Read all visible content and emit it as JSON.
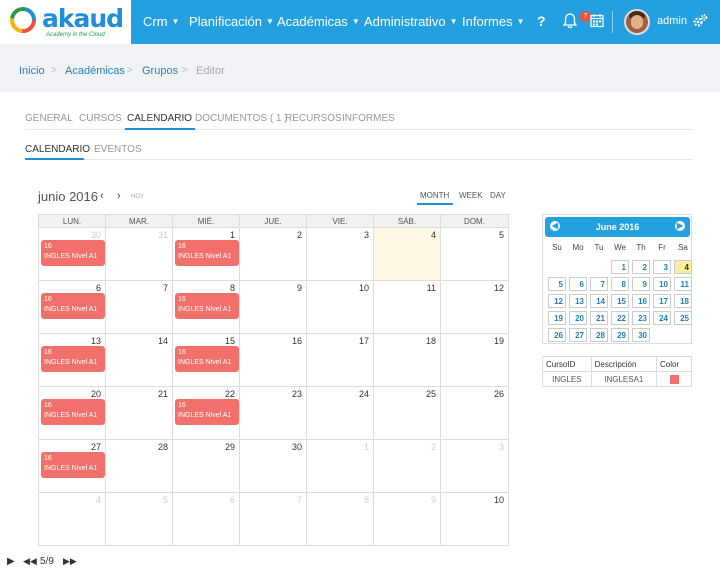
{
  "app": {
    "logo_text": "akaud",
    "logo_sub": "Academy in the Cloud"
  },
  "topnav": {
    "items": [
      "Crm",
      "Planificación",
      "Académicas",
      "Administrativo",
      "Informes"
    ],
    "help": "?",
    "notif_count": "7",
    "user": "admin"
  },
  "breadcrumb": {
    "items": [
      "Inicio",
      "Académicas",
      "Grupos"
    ],
    "current": "Editor"
  },
  "tabs": [
    "GENERAL",
    "CURSOS",
    "CALENDARIO",
    "DOCUMENTOS ( 1 )",
    "RECURSOS",
    "INFORMES"
  ],
  "active_tab": "CALENDARIO",
  "subtabs": [
    "CALENDARIO",
    "EVENTOS"
  ],
  "calendar": {
    "title": "junio 2016",
    "prev": "‹",
    "next": "›",
    "today_label": "HOY",
    "views": [
      "MONTH",
      "WEEK",
      "DAY"
    ],
    "active_view": "MONTH",
    "dow": [
      "LUN.",
      "MAR.",
      "MIÉ.",
      "JUE.",
      "VIE.",
      "SÁB.",
      "DOM."
    ],
    "weeks": [
      [
        "30",
        "31",
        "1",
        "2",
        "3",
        "4",
        "5"
      ],
      [
        "6",
        "7",
        "8",
        "9",
        "10",
        "11",
        "12"
      ],
      [
        "13",
        "14",
        "15",
        "16",
        "17",
        "18",
        "19"
      ],
      [
        "20",
        "21",
        "22",
        "23",
        "24",
        "25",
        "26"
      ],
      [
        "27",
        "28",
        "29",
        "30",
        "1",
        "2",
        "3"
      ],
      [
        "4",
        "5",
        "6",
        "7",
        "8",
        "9",
        "10"
      ]
    ],
    "event_line1": "16",
    "event_line2": "INGLES Nivel A1"
  },
  "mini": {
    "title": "June 2016",
    "dow": [
      "Su",
      "Mo",
      "Tu",
      "We",
      "Th",
      "Fr",
      "Sa"
    ],
    "weeks": [
      [
        "",
        "",
        "",
        "1",
        "2",
        "3",
        "4"
      ],
      [
        "5",
        "6",
        "7",
        "8",
        "9",
        "10",
        "11"
      ],
      [
        "12",
        "13",
        "14",
        "15",
        "16",
        "17",
        "18"
      ],
      [
        "19",
        "20",
        "21",
        "22",
        "23",
        "24",
        "25"
      ],
      [
        "26",
        "27",
        "28",
        "29",
        "30",
        "",
        ""
      ]
    ],
    "today": "4"
  },
  "legend_table": {
    "headers": [
      "CursoID",
      "Descripción",
      "Color"
    ],
    "rows": [
      [
        "INGLES",
        "INGLESA1"
      ]
    ],
    "color": "#f2706b"
  },
  "player": {
    "page": "5/9"
  },
  "colors": {
    "accent": "#22a0e0",
    "event": "#f2706b",
    "today": "#fcf8e3"
  }
}
